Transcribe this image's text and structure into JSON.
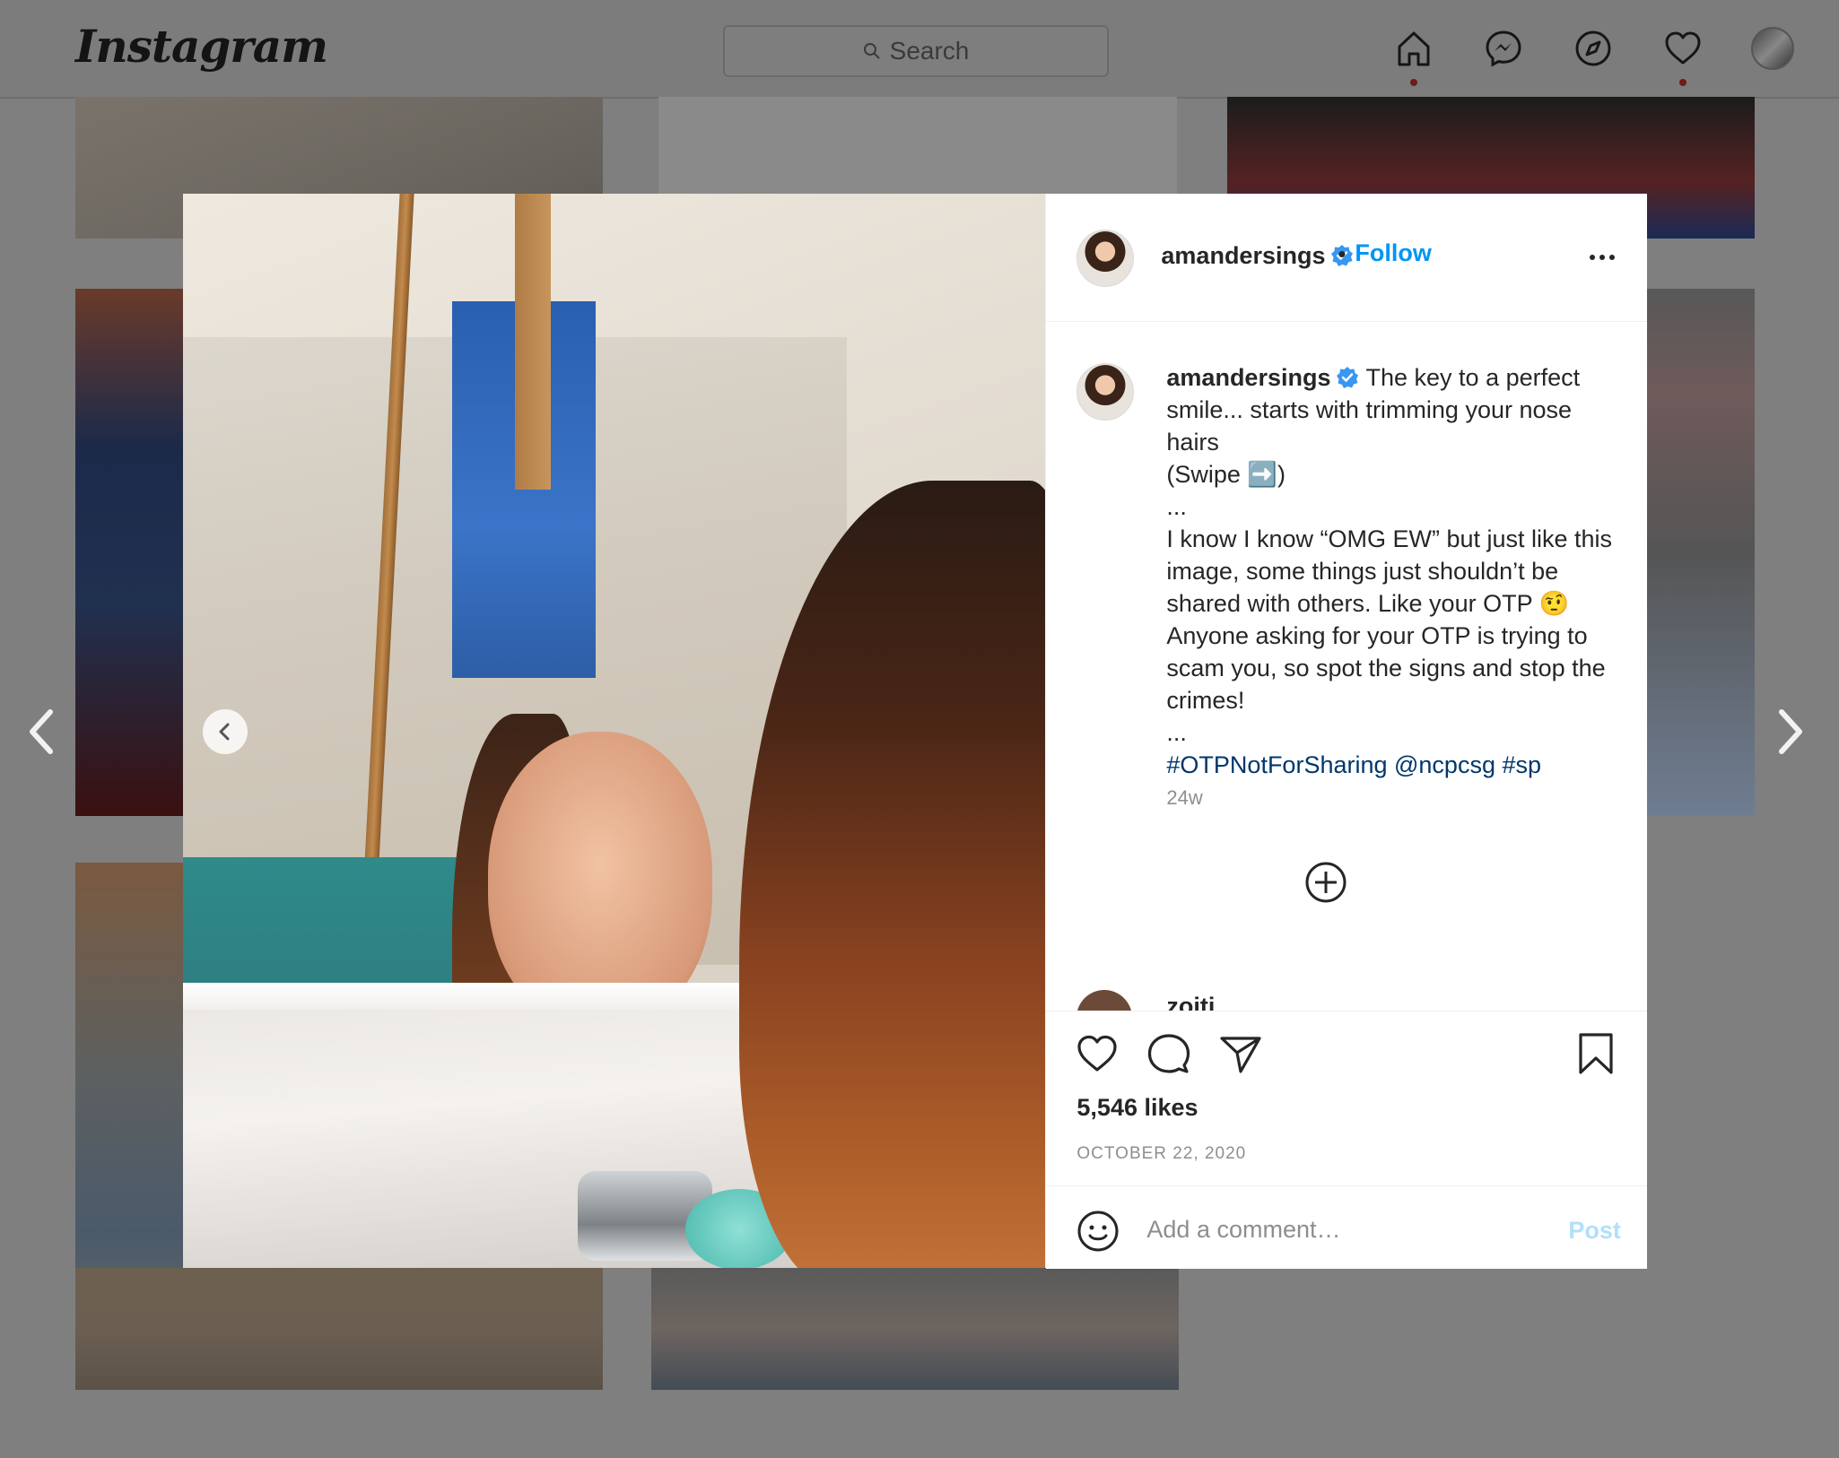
{
  "app": {
    "logo": "Instagram",
    "search_placeholder": "Search"
  },
  "nav": {
    "icons": [
      "home-icon",
      "messenger-icon",
      "explore-icon",
      "activity-heart-icon",
      "profile-avatar"
    ]
  },
  "post": {
    "username": "amandersings",
    "verified": true,
    "follow_label": "Follow",
    "caption_username": "amandersings",
    "caption_lines": "The key to a perfect smile... starts with trimming your nose hairs\n(Swipe ➡️)\n...\nI know I know “OMG EW” but just like this image, some things just shouldn’t be shared with others. Like your OTP 🤨 Anyone asking for your OTP is trying to scam you, so spot the signs and stop the crimes!\n...",
    "hashtags": "#OTPNotForSharing @ncpcsg #sp",
    "age": "24w",
    "next_comment_user": "zoiti",
    "likes": "5,546 likes",
    "date": "OCTOBER 22, 2020",
    "comment_placeholder": "Add a comment…",
    "post_label": "Post"
  },
  "colors": {
    "accent": "#0095f6",
    "text": "#262626",
    "muted": "#8e8e8e",
    "hashtag": "#00376b",
    "overlay": "#7f7f7f"
  }
}
